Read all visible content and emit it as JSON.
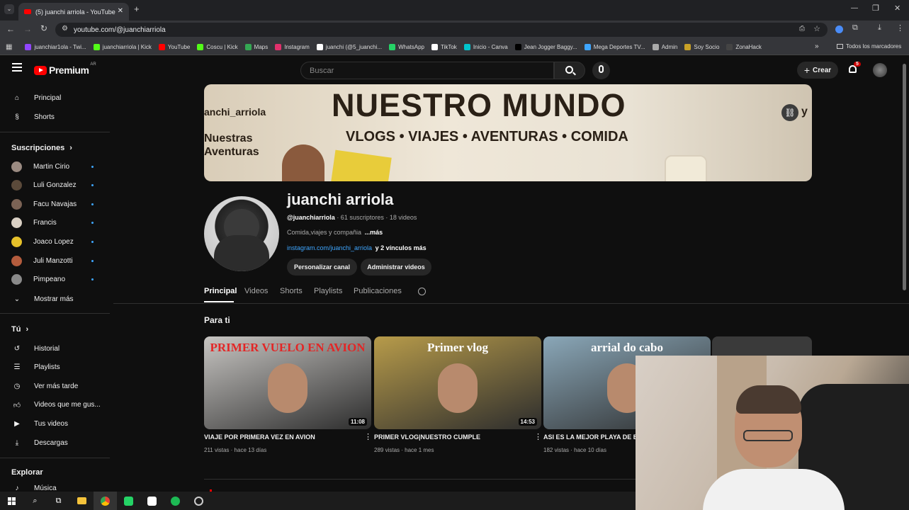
{
  "browser": {
    "tab_title": "(5) juanchi arriola - YouTube",
    "url": "youtube.com/@juanchiarriola",
    "bookmarks": [
      {
        "label": "juanchiar1ola - Twi...",
        "color": "#9146ff"
      },
      {
        "label": "juanchiarriola | Kick",
        "color": "#53fc18"
      },
      {
        "label": "YouTube",
        "color": "#ff0000"
      },
      {
        "label": "Coscu | Kick",
        "color": "#53fc18"
      },
      {
        "label": "Maps",
        "color": "#34a853"
      },
      {
        "label": "Instagram",
        "color": "#e1306c"
      },
      {
        "label": "juanchi (@5_juanchi...",
        "color": "#ffffff"
      },
      {
        "label": "WhatsApp",
        "color": "#25d366"
      },
      {
        "label": "TikTok",
        "color": "#ffffff"
      },
      {
        "label": "Inicio - Canva",
        "color": "#00c4cc"
      },
      {
        "label": "Jean Jogger Baggy...",
        "color": "#000000"
      },
      {
        "label": "Mega Deportes TV...",
        "color": "#3ea6ff"
      },
      {
        "label": "Admin",
        "color": "#aaaaaa"
      },
      {
        "label": "Soy Socio",
        "color": "#c9a227"
      },
      {
        "label": "ZonaHack",
        "color": "#444444"
      }
    ],
    "all_bookmarks": "Todos los marcadores"
  },
  "header": {
    "logo": "Premium",
    "logo_region": "AR",
    "search_placeholder": "Buscar",
    "create_label": "Crear",
    "notif_count": "5"
  },
  "sidebar": {
    "main": [
      {
        "label": "Principal",
        "icon": "home-icon"
      },
      {
        "label": "Shorts",
        "icon": "shorts-icon"
      }
    ],
    "subs_title": "Suscripciones",
    "subs": [
      {
        "label": "Martin Cirio",
        "color": "#9b8b82"
      },
      {
        "label": "Luli Gonzalez",
        "color": "#5b4a3a"
      },
      {
        "label": "Facu Navajas",
        "color": "#7b6355"
      },
      {
        "label": "Francis",
        "color": "#d9d0c4"
      },
      {
        "label": "Joaco Lopez",
        "color": "#e6c12a"
      },
      {
        "label": "Juli Manzotti",
        "color": "#b45c3d"
      },
      {
        "label": "Pimpeano",
        "color": "#8a8a8a"
      }
    ],
    "show_more": "Mostrar más",
    "you_title": "Tú",
    "you": [
      {
        "label": "Historial",
        "icon": "history-icon"
      },
      {
        "label": "Playlists",
        "icon": "playlists-icon"
      },
      {
        "label": "Ver más tarde",
        "icon": "watch-later-icon"
      },
      {
        "label": "Videos que me gus...",
        "icon": "like-icon"
      },
      {
        "label": "Tus videos",
        "icon": "your-videos-icon"
      },
      {
        "label": "Descargas",
        "icon": "download-icon"
      }
    ],
    "explore_title": "Explorar",
    "explore": [
      {
        "label": "Música",
        "icon": "music-icon"
      }
    ]
  },
  "banner": {
    "title": "NUESTRO MUNDO",
    "subtitle": "VLOGS • VIAJES • AVENTURAS • COMIDA",
    "left_handle": "anchi_arriola",
    "left_caption": "Nuestras\nAventuras",
    "right_letter": "y"
  },
  "channel": {
    "name": "juanchi arriola",
    "handle": "@juanchiarriola",
    "subscribers": "· 61 suscriptores",
    "videos_count": "· 18 videos",
    "description": "Comida,viajes y compañia",
    "more": "...más",
    "link": "instagram.com/juanchi_arriola",
    "links_more": "y 2 vínculos más",
    "btn_customize": "Personalizar canal",
    "btn_manage": "Administrar videos"
  },
  "tabs": [
    "Principal",
    "Videos",
    "Shorts",
    "Playlists",
    "Publicaciones"
  ],
  "section_title": "Para ti",
  "videos": [
    {
      "title": "VIAJE POR PRIMERA VEZ EN AVION",
      "views": "211 vistas",
      "age": "hace 13 días",
      "duration": "11:08",
      "overlay": "PRIMER VUELO EN AVION",
      "bg": "#c7c5c2",
      "overlay_color": "#e32626"
    },
    {
      "title": "PRIMER VLOG|NUESTRO CUMPLE",
      "views": "289 vistas",
      "age": "hace 1 mes",
      "duration": "14:53",
      "overlay": "Primer vlog",
      "bg": "#b79b4a",
      "overlay_color": "#ffffff"
    },
    {
      "title": "ASI ES LA MEJOR PLAYA DE BR",
      "views": "182 vistas",
      "age": "hace 10 días",
      "duration": "",
      "overlay": "arrial do cabo",
      "bg": "#8aa7b8",
      "overlay_color": "#ffffff"
    }
  ]
}
